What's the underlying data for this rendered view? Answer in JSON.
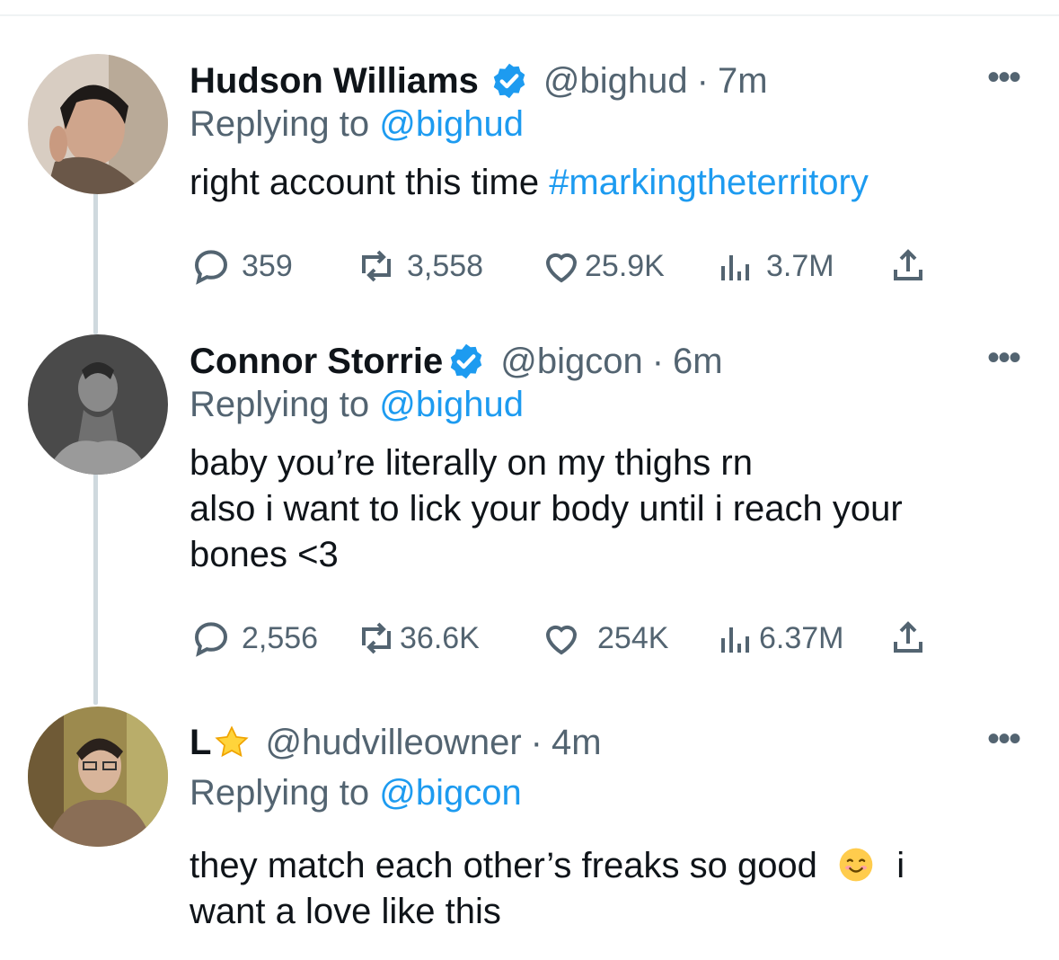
{
  "tweets": [
    {
      "display_name": "Hudson Williams",
      "verified": true,
      "handle": "@bighud",
      "separator": "·",
      "time": "7m",
      "replying_prefix": "Replying to",
      "replying_to": "@bighud",
      "text": "right account this time",
      "hashtag": "#markingtheterritory",
      "stats": {
        "replies": "359",
        "retweets": "3,558",
        "likes": "25.9K",
        "views": "3.7M"
      }
    },
    {
      "display_name": "Connor Storrie",
      "verified": true,
      "handle": "@bigcon",
      "separator": "·",
      "time": "6m",
      "replying_prefix": "Replying to",
      "replying_to": "@bighud",
      "text_lines": [
        "baby you’re literally on my thighs rn",
        "also i want to lick your body until i reach your",
        "bones <3"
      ],
      "stats": {
        "replies": "2,556",
        "retweets": "36.6K",
        "likes": "254K",
        "views": "6.37M"
      }
    },
    {
      "display_name": "L",
      "name_emoji": "star",
      "handle": "@hudvilleowner",
      "separator": "·",
      "time": "4m",
      "replying_prefix": "Replying to",
      "replying_to": "@bigcon",
      "text_line1_before": "they match each other’s freaks so good",
      "text_line1_emoji": "smiling-face",
      "text_line1_after": "i",
      "text_line2": "want a love like this"
    }
  ],
  "more_label": "•••",
  "colors": {
    "accent": "#1d9bf0",
    "secondary_text": "#536471",
    "primary_text": "#0f1419",
    "thread_line": "#cfd9de"
  }
}
